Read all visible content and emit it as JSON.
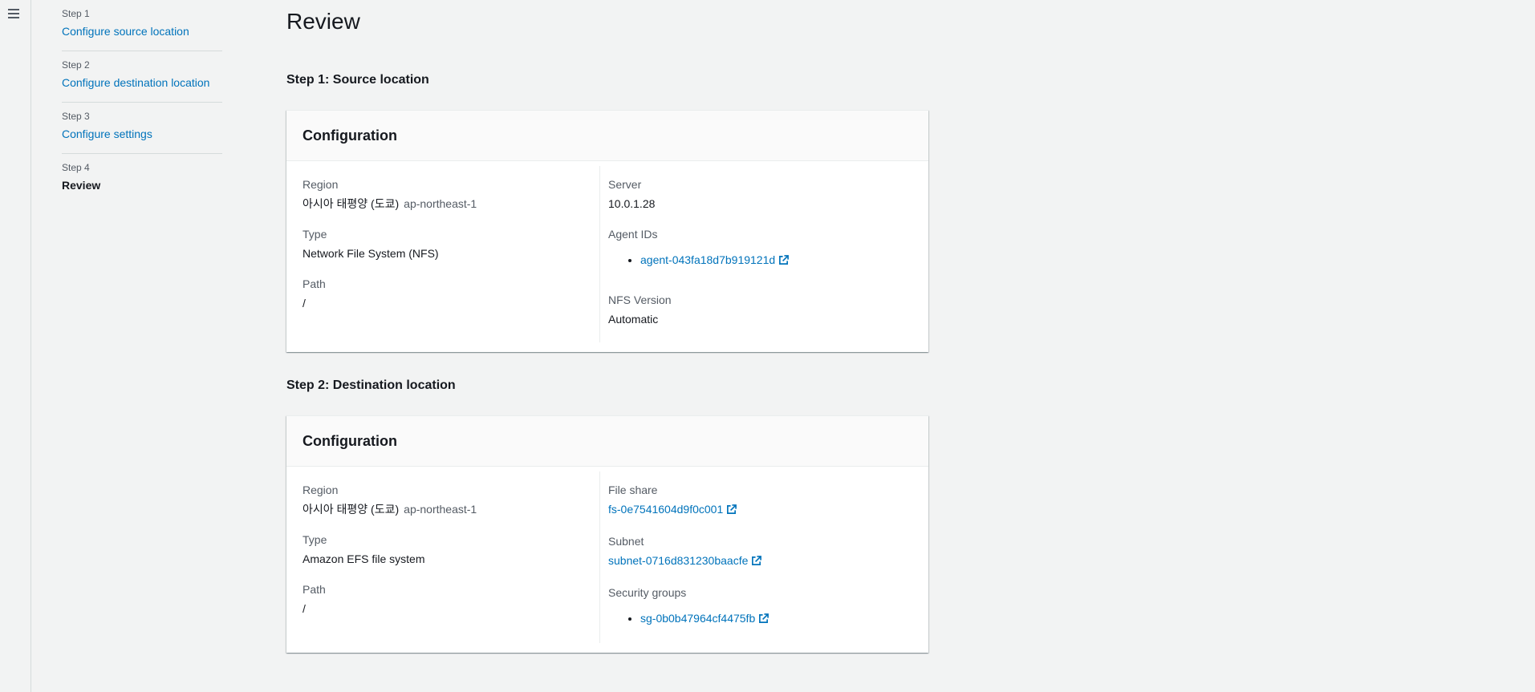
{
  "nav": {
    "menu_icon": "hamburger-icon"
  },
  "steps": [
    {
      "num": "Step 1",
      "label": "Configure source location"
    },
    {
      "num": "Step 2",
      "label": "Configure destination location"
    },
    {
      "num": "Step 3",
      "label": "Configure settings"
    },
    {
      "num": "Step 4",
      "label": "Review"
    }
  ],
  "page": {
    "title": "Review"
  },
  "source": {
    "section_title": "Step 1: Source location",
    "panel_title": "Configuration",
    "region_label": "Region",
    "region_name": "아시아 태평양 (도쿄)",
    "region_code": "ap-northeast-1",
    "type_label": "Type",
    "type_value": "Network File System (NFS)",
    "path_label": "Path",
    "path_value": "/",
    "server_label": "Server",
    "server_value": "10.0.1.28",
    "agents_label": "Agent IDs",
    "agents": [
      "agent-043fa18d7b919121d"
    ],
    "nfs_label": "NFS Version",
    "nfs_value": "Automatic"
  },
  "destination": {
    "section_title": "Step 2: Destination location",
    "panel_title": "Configuration",
    "region_label": "Region",
    "region_name": "아시아 태평양 (도쿄)",
    "region_code": "ap-northeast-1",
    "type_label": "Type",
    "type_value": "Amazon EFS file system",
    "path_label": "Path",
    "path_value": "/",
    "fileshare_label": "File share",
    "fileshare_value": "fs-0e7541604d9f0c001",
    "subnet_label": "Subnet",
    "subnet_value": "subnet-0716d831230baacfe",
    "sg_label": "Security groups",
    "security_groups": [
      "sg-0b0b47964cf4475fb"
    ]
  },
  "colors": {
    "link": "#0073bb",
    "background": "#f2f3f3"
  }
}
